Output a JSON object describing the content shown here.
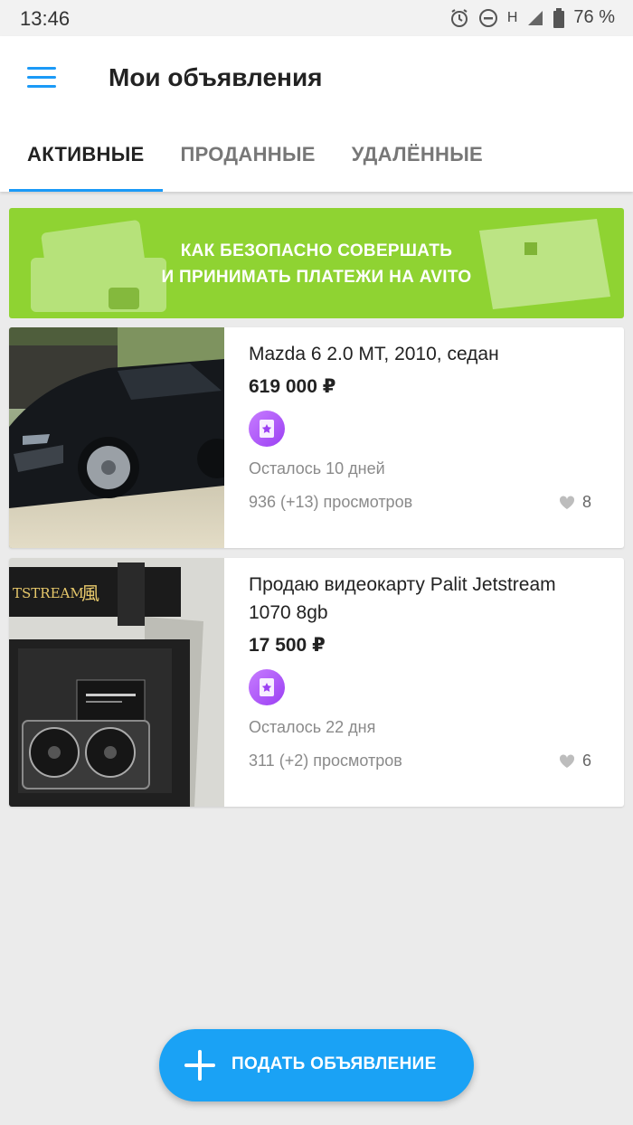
{
  "status_bar": {
    "time": "13:46",
    "network": "H",
    "battery": "76 %"
  },
  "header": {
    "title": "Мои объявления",
    "menu_icon": "hamburger-menu-icon"
  },
  "tabs": [
    {
      "label": "АКТИВНЫЕ",
      "active": true
    },
    {
      "label": "ПРОДАННЫЕ",
      "active": false
    },
    {
      "label": "УДАЛЁННЫЕ",
      "active": false
    }
  ],
  "banner": {
    "line1": "КАК БЕЗОПАСНО СОВЕРШАТЬ",
    "line2": "И ПРИНИМАТЬ ПЛАТЕЖИ НА AVITO",
    "color": "#8fd332"
  },
  "listings": [
    {
      "title": "Mazda 6 2.0 MT, 2010, седан",
      "price": "619 000 ₽",
      "expires": "Осталось 10 дней",
      "views": "936 (+13) просмотров",
      "likes": "8",
      "image": "black-car-photo"
    },
    {
      "title": "Продаю видеокарту Palit Jetstream 1070 8gb",
      "price": "17 500 ₽",
      "expires": "Осталось 22 дня",
      "views": "311 (+2) просмотров",
      "likes": "6",
      "image": "graphics-card-photo"
    }
  ],
  "fab": {
    "label": "ПОДАТЬ ОБЪЯВЛЕНИЕ",
    "icon": "plus-icon"
  },
  "colors": {
    "accent": "#1b9af7",
    "banner": "#8fd332",
    "promo": "#9b3ff3"
  }
}
